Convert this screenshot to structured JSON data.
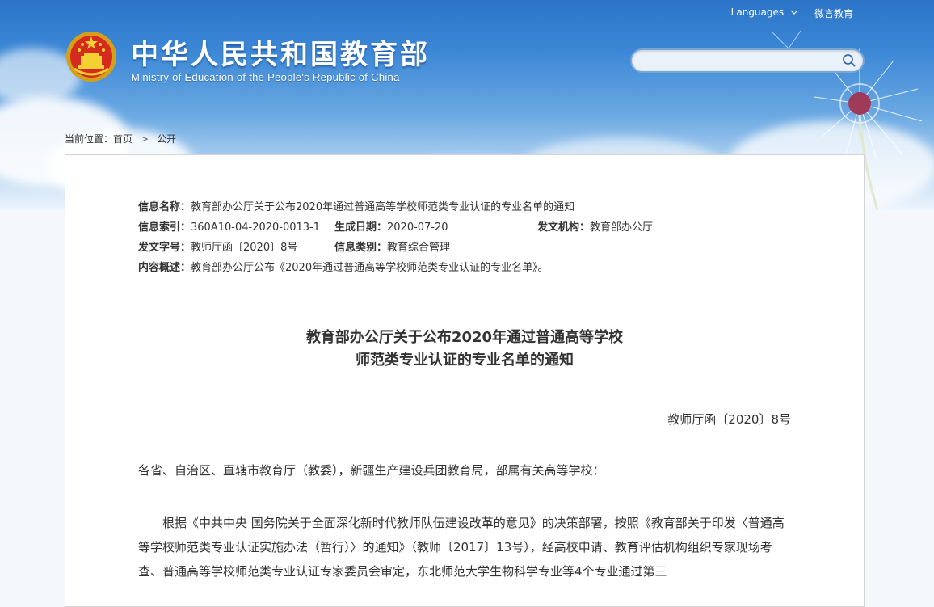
{
  "topnav": {
    "languages": "Languages",
    "weibo": "微言教育"
  },
  "site": {
    "title": "中华人民共和国教育部",
    "subtitle": "Ministry of Education of the People's Republic of China"
  },
  "search": {
    "value": "",
    "placeholder": ""
  },
  "breadcrumb": {
    "prefix": "当前位置：",
    "home": "首页",
    "sep": ">",
    "current": "公开"
  },
  "meta": {
    "name_label": "信息名称：",
    "name_value": "教育部办公厅关于公布2020年通过普通高等学校师范类专业认证的专业名单的通知",
    "index_label": "信息索引：",
    "index_value": "360A10-04-2020-0013-1",
    "date_label": "生成日期：",
    "date_value": "2020-07-20",
    "org_label": "发文机构：",
    "org_value": "教育部办公厅",
    "docno_label": "发文字号：",
    "docno_value": "教师厅函〔2020〕8号",
    "category_label": "信息类别：",
    "category_value": "教育综合管理",
    "summary_label": "内容概述：",
    "summary_value": "教育部办公厅公布《2020年通过普通高等学校师范类专业认证的专业名单》。"
  },
  "article": {
    "title_line1": "教育部办公厅关于公布2020年通过普通高等学校",
    "title_line2": "师范类专业认证的专业名单的通知",
    "doc_number": "教师厅函〔2020〕8号",
    "salutation": "各省、自治区、直辖市教育厅（教委），新疆生产建设兵团教育局，部属有关高等学校：",
    "paragraph1": "根据《中共中央 国务院关于全面深化新时代教师队伍建设改革的意见》的决策部署，按照《教育部关于印发〈普通高等学校师范类专业认证实施办法（暂行）〉的通知》（教师〔2017〕13号），经高校申请、教育评估机构组织专家现场考查、普通高等学校师范类专业认证专家委员会审定，东北师范大学生物科学专业等4个专业通过第三"
  },
  "colors": {
    "sky_top": "#2b74c9",
    "card_border": "#d4d4d4",
    "text": "#333333"
  },
  "icons": [
    "national-emblem-icon",
    "search-icon",
    "chevron-down-icon"
  ]
}
